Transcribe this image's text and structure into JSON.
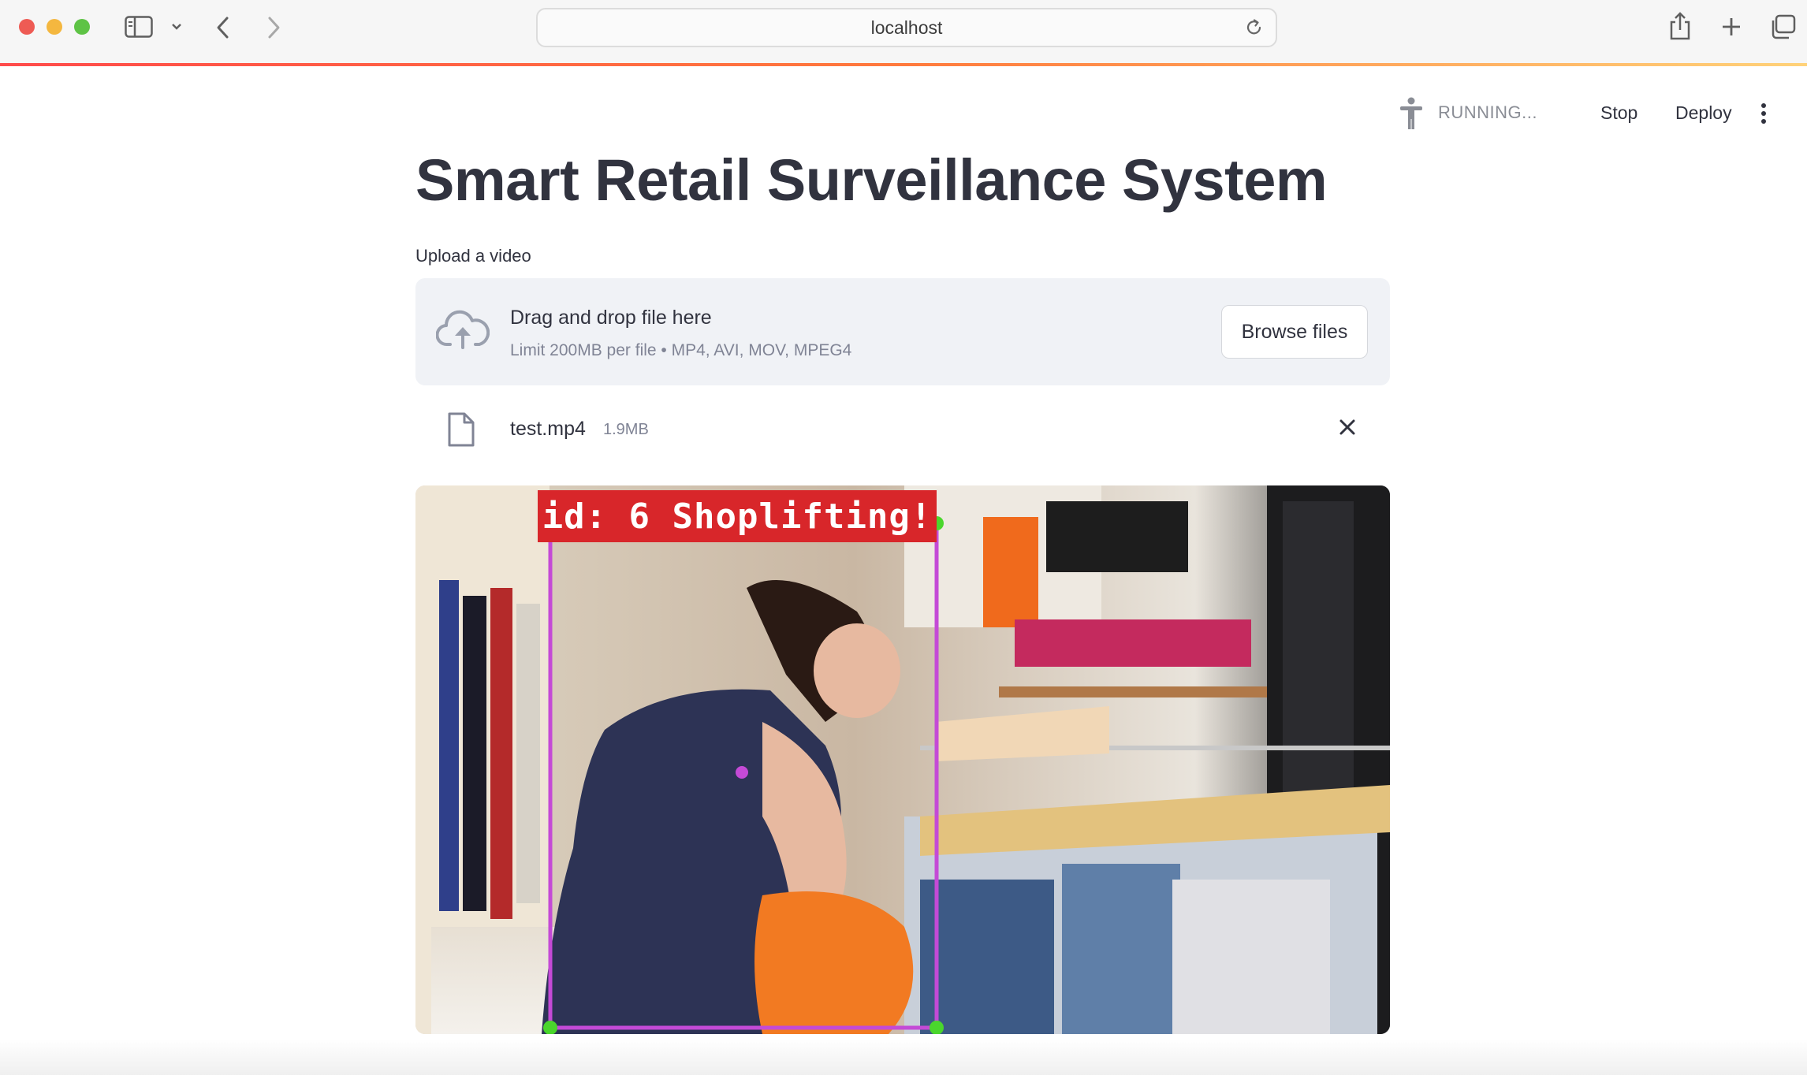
{
  "browser": {
    "url": "localhost"
  },
  "header": {
    "status": "RUNNING...",
    "stop_label": "Stop",
    "deploy_label": "Deploy"
  },
  "page": {
    "title": "Smart Retail Surveillance System"
  },
  "uploader": {
    "label": "Upload a video",
    "drop_text": "Drag and drop file here",
    "limit_text": "Limit 200MB per file • MP4, AVI, MOV, MPEG4",
    "browse_label": "Browse files"
  },
  "file": {
    "name": "test.mp4",
    "size": "1.9MB"
  },
  "video": {
    "overlay_text": "id: 6 Shoplifting!",
    "box_color": "#c44ad6",
    "label_bg": "#d8262a"
  },
  "colors": {
    "accent": "#ff4b4b",
    "text": "#31333f",
    "muted": "#808495",
    "dropzone_bg": "#f0f2f6"
  }
}
